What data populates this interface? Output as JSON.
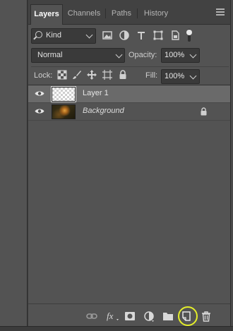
{
  "tabs": [
    {
      "label": "Layers",
      "active": true
    },
    {
      "label": "Channels",
      "active": false
    },
    {
      "label": "Paths",
      "active": false
    },
    {
      "label": "History",
      "active": false
    }
  ],
  "filter": {
    "kind_label": "Kind",
    "icons": [
      "image-filter-icon",
      "adjustment-filter-icon",
      "type-filter-icon",
      "shape-filter-icon",
      "smart-object-filter-icon",
      "filter-toggle-icon"
    ]
  },
  "blend": {
    "mode": "Normal",
    "opacity_label": "Opacity:",
    "opacity_value": "100%"
  },
  "lock": {
    "label": "Lock:",
    "icons": [
      "lock-transparent-pixels-icon",
      "lock-image-pixels-icon",
      "lock-position-icon",
      "lock-artboard-icon",
      "lock-all-icon"
    ],
    "fill_label": "Fill:",
    "fill_value": "100%"
  },
  "layers": [
    {
      "name": "Layer 1",
      "selected": true,
      "visible": true,
      "locked": false,
      "thumb": "transparent"
    },
    {
      "name": "Background",
      "selected": false,
      "visible": true,
      "locked": true,
      "thumb": "photo"
    }
  ],
  "footer_icons": [
    "link-layers-icon",
    "fx-icon",
    "add-mask-icon",
    "adjustment-layer-icon",
    "new-group-icon",
    "new-layer-icon",
    "delete-layer-icon"
  ],
  "colors": {
    "panel": "#535353",
    "selected_row": "#6a6a6a",
    "highlight": "#e4ee2a"
  }
}
